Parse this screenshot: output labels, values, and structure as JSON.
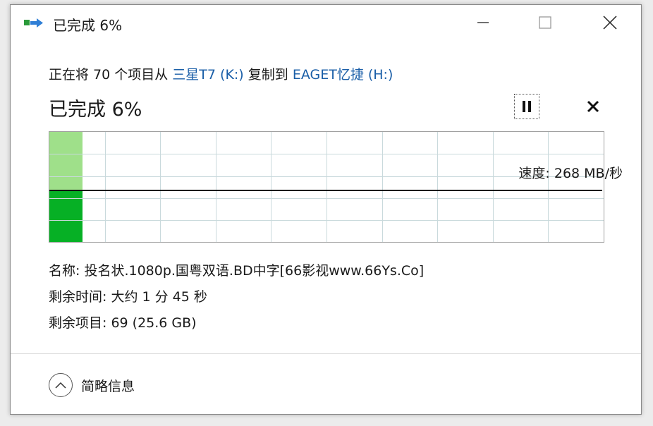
{
  "window": {
    "title": "已完成 6%"
  },
  "header": {
    "desc_prefix": "正在将 70 个项目从 ",
    "source": "三星T7 (K:)",
    "desc_middle": " 复制到 ",
    "destination": "EAGET忆捷 (H:)",
    "percent_text": "已完成 6%"
  },
  "progress": {
    "percent": 6,
    "speed_label": "速度: 268 MB/秒"
  },
  "details": {
    "name": "名称: 投名状.1080p.国粤双语.BD中字[66影视www.66Ys.Co]",
    "time_left": "剩余时间: 大约 1 分 45 秒",
    "items_left": "剩余项目: 69 (25.6 GB)"
  },
  "footer": {
    "toggle_label": "简略信息"
  },
  "colors": {
    "link": "#1b5fa8",
    "progress_dark": "#06b025",
    "progress_light": "#9fe08a",
    "grid": "#c9d9dc"
  }
}
